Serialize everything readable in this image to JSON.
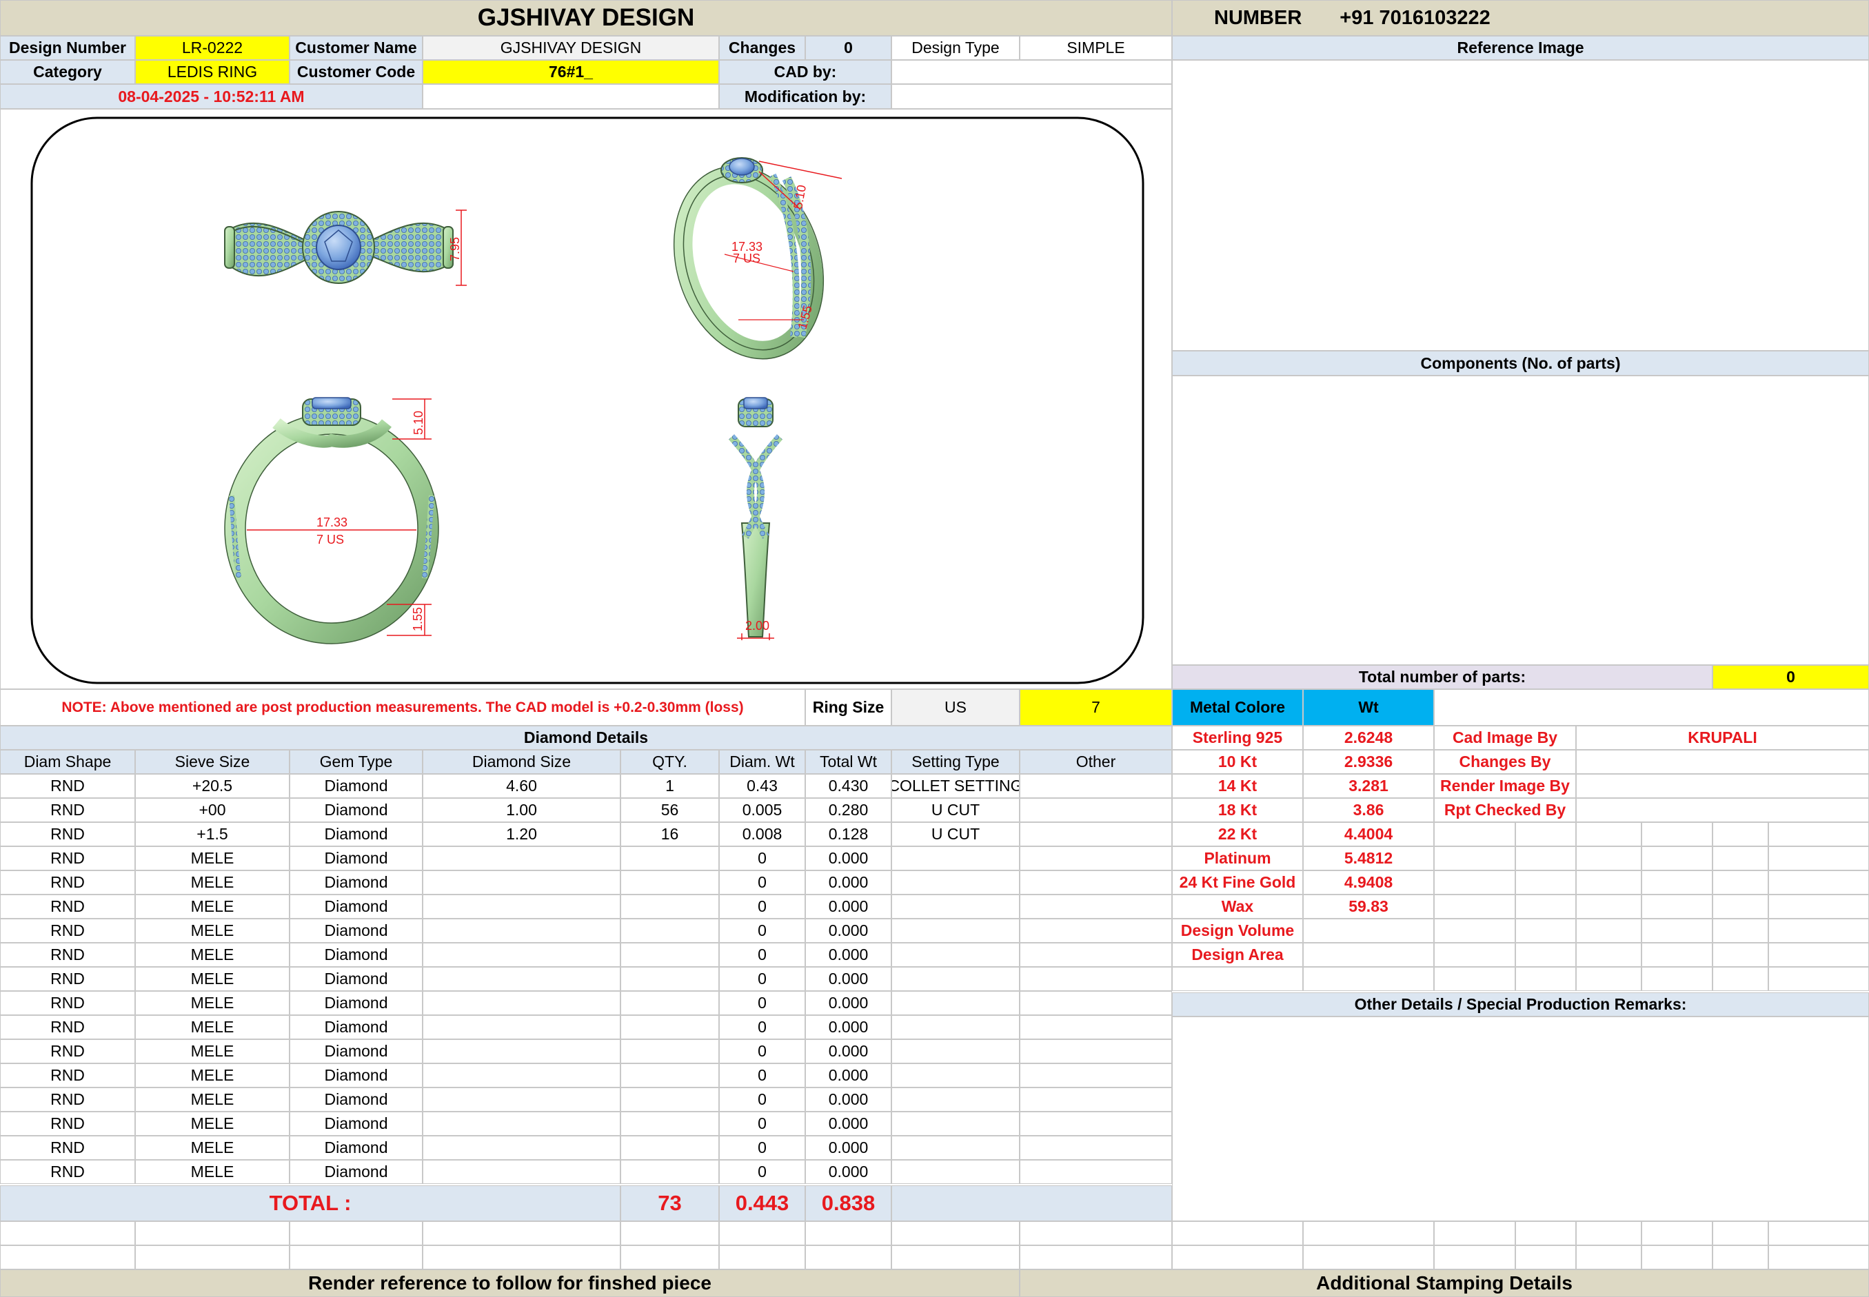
{
  "header": {
    "company": "GJSHIVAY DESIGN",
    "number_label": "NUMBER",
    "number_value": "+91 7016103222"
  },
  "info": {
    "design_number_label": "Design Number",
    "design_number": "LR-0222",
    "customer_name_label": "Customer Name",
    "customer_name": "GJSHIVAY DESIGN",
    "changes_label": "Changes",
    "changes": "0",
    "design_type_label": "Design Type",
    "design_type": "SIMPLE",
    "category_label": "Category",
    "category": "LEDIS RING",
    "customer_code_label": "Customer Code",
    "customer_code": "76#1_",
    "cad_by_label": "CAD by:",
    "datetime": "08-04-2025 - 10:52:11 AM",
    "modification_by_label": "Modification by:"
  },
  "right_panel": {
    "reference_image": "Reference Image",
    "components": "Components (No. of parts)",
    "total_parts_label": "Total number of parts:",
    "total_parts": "0"
  },
  "drawing": {
    "dim_top_height": "7.95",
    "dim_persp_1": "5.10",
    "dim_persp_2": "1.55",
    "dim_persp_diam": "17.33",
    "dim_persp_size": "7 US",
    "dim_front_top": "5.10",
    "dim_front_diam": "17.33",
    "dim_front_size": "7 US",
    "dim_front_bottom": "1.55",
    "dim_side_width": "2.00"
  },
  "note": {
    "text": "NOTE: Above mentioned are post production measurements. The CAD model is +0.2-0.30mm (loss)",
    "ring_size_label": "Ring Size",
    "ring_size_system": "US",
    "ring_size": "7"
  },
  "metal": {
    "col_label": "Metal Colore",
    "wt_label": "Wt",
    "rows": [
      {
        "name": "Sterling 925",
        "wt": "2.6248"
      },
      {
        "name": "10 Kt",
        "wt": "2.9336"
      },
      {
        "name": "14 Kt",
        "wt": "3.281"
      },
      {
        "name": "18 Kt",
        "wt": "3.86"
      },
      {
        "name": "22 Kt",
        "wt": "4.4004"
      },
      {
        "name": "Platinum",
        "wt": "5.4812"
      },
      {
        "name": "24 Kt Fine Gold",
        "wt": "4.9408"
      },
      {
        "name": "Wax",
        "wt": "59.83"
      },
      {
        "name": "Design Volume",
        "wt": ""
      },
      {
        "name": "Design Area",
        "wt": ""
      }
    ]
  },
  "credits": [
    {
      "label": "Cad Image By",
      "value": "KRUPALI"
    },
    {
      "label": "Changes By",
      "value": ""
    },
    {
      "label": "Render Image By",
      "value": ""
    },
    {
      "label": "Rpt Checked By",
      "value": ""
    }
  ],
  "other_details": "Other Details / Special Production Remarks:",
  "diamond": {
    "title": "Diamond Details",
    "headers": [
      "Diam Shape",
      "Sieve Size",
      "Gem Type",
      "Diamond Size",
      "QTY.",
      "Diam. Wt",
      "Total Wt",
      "Setting Type",
      "Other"
    ],
    "rows": [
      [
        "RND",
        "+20.5",
        "Diamond",
        "4.60",
        "1",
        "0.43",
        "0.430",
        "COLLET SETTING",
        ""
      ],
      [
        "RND",
        "+00",
        "Diamond",
        "1.00",
        "56",
        "0.005",
        "0.280",
        "U CUT",
        ""
      ],
      [
        "RND",
        "+1.5",
        "Diamond",
        "1.20",
        "16",
        "0.008",
        "0.128",
        "U CUT",
        ""
      ],
      [
        "RND",
        "MELE",
        "Diamond",
        "",
        "",
        "0",
        "0.000",
        "",
        ""
      ],
      [
        "RND",
        "MELE",
        "Diamond",
        "",
        "",
        "0",
        "0.000",
        "",
        ""
      ],
      [
        "RND",
        "MELE",
        "Diamond",
        "",
        "",
        "0",
        "0.000",
        "",
        ""
      ],
      [
        "RND",
        "MELE",
        "Diamond",
        "",
        "",
        "0",
        "0.000",
        "",
        ""
      ],
      [
        "RND",
        "MELE",
        "Diamond",
        "",
        "",
        "0",
        "0.000",
        "",
        ""
      ],
      [
        "RND",
        "MELE",
        "Diamond",
        "",
        "",
        "0",
        "0.000",
        "",
        ""
      ],
      [
        "RND",
        "MELE",
        "Diamond",
        "",
        "",
        "0",
        "0.000",
        "",
        ""
      ],
      [
        "RND",
        "MELE",
        "Diamond",
        "",
        "",
        "0",
        "0.000",
        "",
        ""
      ],
      [
        "RND",
        "MELE",
        "Diamond",
        "",
        "",
        "0",
        "0.000",
        "",
        ""
      ],
      [
        "RND",
        "MELE",
        "Diamond",
        "",
        "",
        "0",
        "0.000",
        "",
        ""
      ],
      [
        "RND",
        "MELE",
        "Diamond",
        "",
        "",
        "0",
        "0.000",
        "",
        ""
      ],
      [
        "RND",
        "MELE",
        "Diamond",
        "",
        "",
        "0",
        "0.000",
        "",
        ""
      ],
      [
        "RND",
        "MELE",
        "Diamond",
        "",
        "",
        "0",
        "0.000",
        "",
        ""
      ],
      [
        "RND",
        "MELE",
        "Diamond",
        "",
        "",
        "0",
        "0.000",
        "",
        ""
      ]
    ],
    "total_label": "TOTAL :",
    "total_qty": "73",
    "total_diam_wt": "0.443",
    "total_wt": "0.838"
  },
  "footer": {
    "left": "Render reference to follow for finshed piece",
    "right": "Additional Stamping Details"
  },
  "colors": {
    "metal_green": "#a9d79f",
    "gem_blue": "#7fb1e0",
    "highlight_yellow": "#ffff00",
    "header_beige": "#ddd9c4",
    "dim_red": "#e8191e",
    "metal_header_cyan": "#00b0f0"
  }
}
